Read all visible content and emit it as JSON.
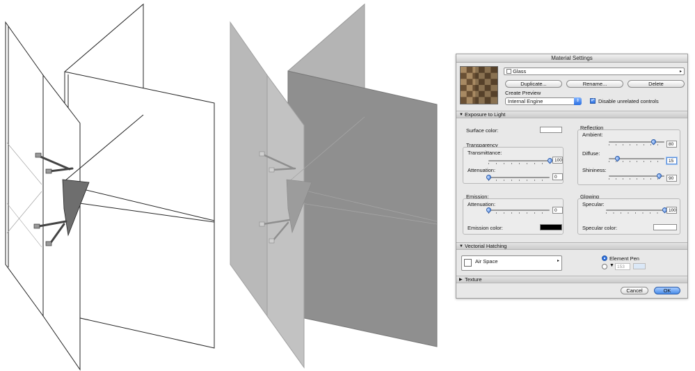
{
  "dialog": {
    "title": "Material Settings",
    "material_name": "Glass",
    "buttons": {
      "duplicate": "Duplicate...",
      "rename": "Rename...",
      "delete": "Delete"
    },
    "create_preview_label": "Create Preview",
    "engine": "Internal Engine",
    "disable_unrelated": {
      "label": "Disable unrelated controls",
      "checked": true
    },
    "sections": {
      "exposure": "Exposure to Light",
      "hatching": "Vectorial Hatching",
      "texture": "Texture"
    },
    "surface_color_label": "Surface color:",
    "transparency": {
      "title": "Transparency",
      "transmittance_label": "Transmittance:",
      "transmittance_value": "100",
      "attenuation_label": "Attenuation:",
      "attenuation_value": "0"
    },
    "reflection": {
      "title": "Reflection",
      "ambient_label": "Ambient:",
      "ambient_value": "80",
      "diffuse_label": "Diffuse:",
      "diffuse_value": "15",
      "shininess_label": "Shininess:",
      "shininess_value": "90"
    },
    "emission": {
      "title": "Emission:",
      "attenuation_label": "Attenuation:",
      "attenuation_value": "0",
      "color_label": "Emission color:"
    },
    "glowing": {
      "title": "Glowing",
      "specular_label": "Specular:",
      "specular_value": "100",
      "specular_color_label": "Specular color:"
    },
    "hatching": {
      "fill_name": "Air Space",
      "element_pen_label": "Element Pen",
      "pen_number": "153"
    },
    "footer": {
      "cancel": "Cancel",
      "ok": "OK"
    },
    "colors": {
      "surface": "#ffffff",
      "emission": "#000000",
      "specular": "#ffffff",
      "accent": "#3c7be0"
    }
  }
}
